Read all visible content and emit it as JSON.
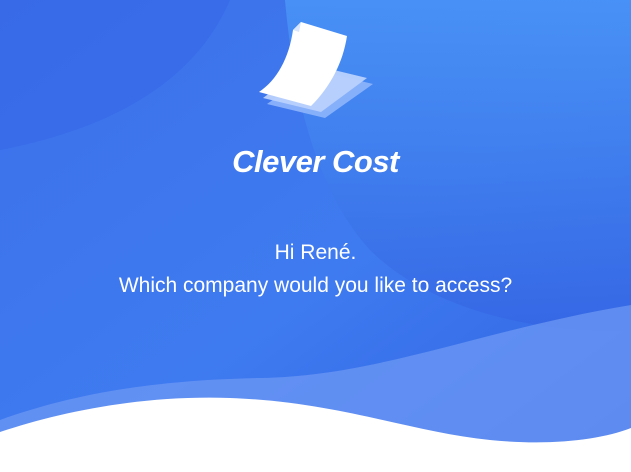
{
  "app": {
    "name": "Clever Cost",
    "logo_icon": "document-stack-icon"
  },
  "welcome": {
    "greeting": "Hi René.",
    "prompt": "Which company would you like to access?"
  },
  "colors": {
    "background_primary": "#3b74ec",
    "background_light": "#4690f6",
    "background_dark": "#2f60e0",
    "text": "#ffffff",
    "bottom_panel": "#ffffff"
  }
}
